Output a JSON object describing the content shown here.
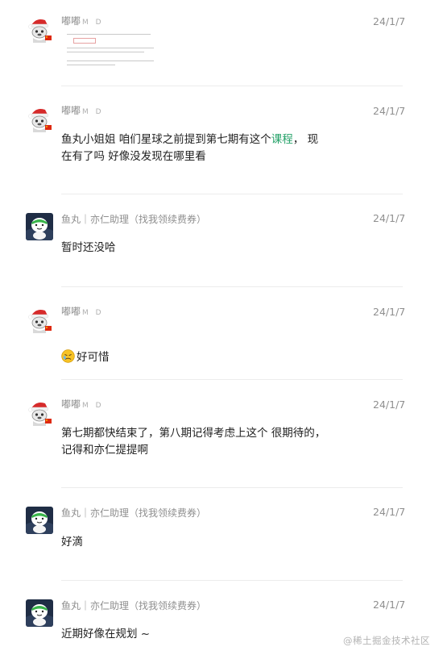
{
  "messages": [
    {
      "user": "嘟嘟",
      "user_tag": "M D",
      "time": "24/1/7",
      "avatar": "santa-avatar",
      "attachment": "document-thumbnail",
      "text": ""
    },
    {
      "user": "嘟嘟",
      "user_tag": "M D",
      "time": "24/1/7",
      "avatar": "santa-avatar",
      "text_before": "鱼丸小姐姐  咱们星球之前提到第七期有这个",
      "text_link": "课程",
      "text_after": "，   现\n在有了吗 好像没发现在哪里看"
    },
    {
      "user": "鱼丸｜亦仁助理（找我领续费券）",
      "user_tag": "",
      "time": "24/1/7",
      "avatar": "cartoon-avatar",
      "text": "暂时还没哈"
    },
    {
      "user": "嘟嘟",
      "user_tag": "M D",
      "time": "24/1/7",
      "avatar": "santa-avatar",
      "emoji": "sad-emoji",
      "text": "好可惜"
    },
    {
      "user": "嘟嘟",
      "user_tag": "M D",
      "time": "24/1/7",
      "avatar": "santa-avatar",
      "text": "第七期都快结束了，第八期记得考虑上这个 很期待的，\n记得和亦仁提提啊"
    },
    {
      "user": "鱼丸｜亦仁助理（找我领续费券）",
      "user_tag": "",
      "time": "24/1/7",
      "avatar": "cartoon-avatar",
      "text": "好滴"
    },
    {
      "user": "鱼丸｜亦仁助理（找我领续费券）",
      "user_tag": "",
      "time": "24/1/7",
      "avatar": "cartoon-avatar",
      "text": "近期好像在规划 ~"
    }
  ],
  "watermark": "@稀土掘金技术社区",
  "colors": {
    "link_green": "#26a269",
    "meta_gray": "#8f8f8f",
    "divider": "#ececec"
  }
}
